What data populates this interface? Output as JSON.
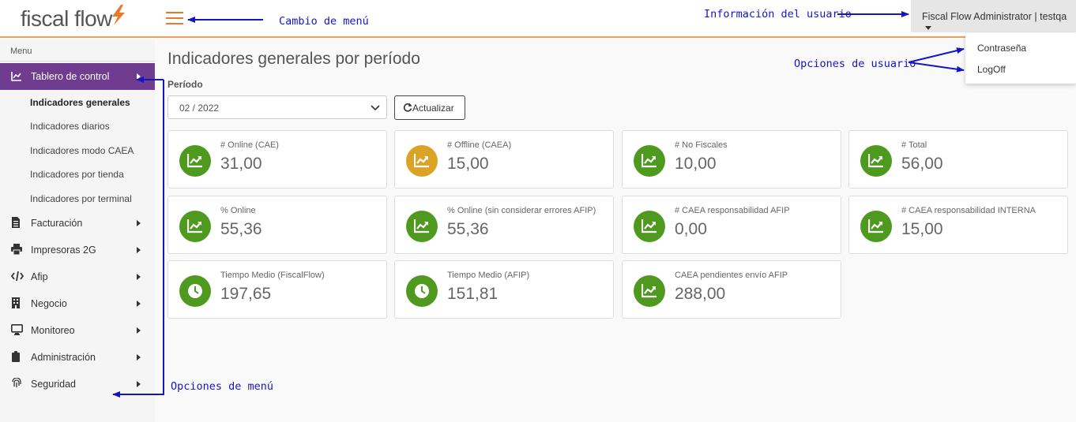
{
  "app": {
    "logo_text": "fiscal flow",
    "menu_toggle_icon": "hamburger-icon"
  },
  "user": {
    "name": "Fiscal Flow Administrator | testqa",
    "dropdown": [
      "Contraseña",
      "LogOff"
    ]
  },
  "sidebar": {
    "title": "Menu",
    "active": {
      "label": "Tablero de control",
      "icon": "chart-line-icon"
    },
    "subitems": [
      "Indicadores generales",
      "Indicadores diarios",
      "Indicadores modo CAEA",
      "Indicadores por tienda",
      "Indicadores por terminal"
    ],
    "items": [
      {
        "label": "Facturación",
        "icon": "document-icon"
      },
      {
        "label": "Impresoras 2G",
        "icon": "printer-icon"
      },
      {
        "label": "Afip",
        "icon": "code-icon"
      },
      {
        "label": "Negocio",
        "icon": "building-icon"
      },
      {
        "label": "Monitoreo",
        "icon": "monitor-icon"
      },
      {
        "label": "Administración",
        "icon": "clipboard-icon"
      },
      {
        "label": "Seguridad",
        "icon": "fingerprint-icon"
      }
    ]
  },
  "main": {
    "title": "Indicadores generales por período",
    "period_label": "Período",
    "period_value": "02 / 2022",
    "refresh_label": "Actualizar"
  },
  "cards": [
    {
      "label": "# Online (CAE)",
      "value": "31,00",
      "icon": "chart-line-icon",
      "color": "#4e9a1e"
    },
    {
      "label": "# Offline (CAEA)",
      "value": "15,00",
      "icon": "chart-line-icon",
      "color": "#d9a326"
    },
    {
      "label": "# No Fiscales",
      "value": "10,00",
      "icon": "chart-line-icon",
      "color": "#4e9a1e"
    },
    {
      "label": "# Total",
      "value": "56,00",
      "icon": "chart-line-icon",
      "color": "#4e9a1e"
    },
    {
      "label": "% Online",
      "value": "55,36",
      "icon": "chart-line-icon",
      "color": "#4e9a1e"
    },
    {
      "label": "% Online (sin considerar errores AFIP)",
      "value": "55,36",
      "icon": "chart-line-icon",
      "color": "#4e9a1e"
    },
    {
      "label": "# CAEA responsabilidad AFIP",
      "value": "0,00",
      "icon": "chart-line-icon",
      "color": "#4e9a1e"
    },
    {
      "label": "# CAEA responsabilidad INTERNA",
      "value": "15,00",
      "icon": "chart-line-icon",
      "color": "#4e9a1e"
    },
    {
      "label": "Tiempo Medio (FiscalFlow)",
      "value": "197,65",
      "icon": "clock-icon",
      "color": "#4e9a1e"
    },
    {
      "label": "Tiempo Medio (AFIP)",
      "value": "151,81",
      "icon": "clock-icon",
      "color": "#4e9a1e"
    },
    {
      "label": "CAEA pendientes envío AFIP",
      "value": "288,00",
      "icon": "chart-line-icon",
      "color": "#4e9a1e"
    }
  ],
  "annotations": {
    "menu_toggle": "Cambio de menú",
    "user_info": "Información del usuario",
    "user_options": "Opciones de usuario",
    "menu_options": "Opciones de menú"
  },
  "colors": {
    "accent": "#e8792a",
    "sidebar_active": "#6f3c8f",
    "annotation": "#1515c8"
  }
}
